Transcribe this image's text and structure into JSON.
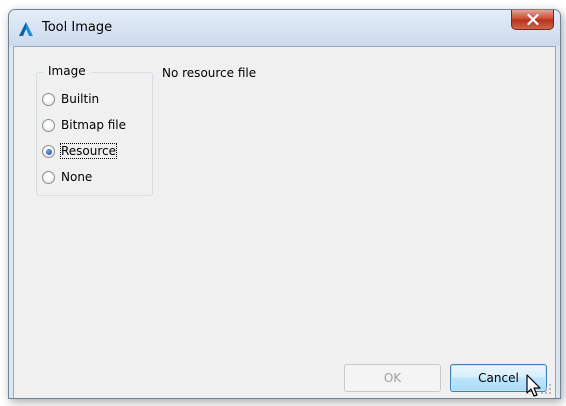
{
  "window": {
    "title": "Tool Image",
    "close_icon": "close-icon"
  },
  "group": {
    "label": "Image",
    "options": [
      {
        "label": "Builtin",
        "checked": false
      },
      {
        "label": "Bitmap file",
        "checked": false
      },
      {
        "label": "Resource",
        "checked": true
      },
      {
        "label": "None",
        "checked": false
      }
    ]
  },
  "info": {
    "text": "No resource file"
  },
  "buttons": {
    "ok_label": "OK",
    "ok_enabled": false,
    "cancel_label": "Cancel"
  },
  "colors": {
    "close_button": "#c9472e",
    "accent": "#3c7fb1"
  }
}
